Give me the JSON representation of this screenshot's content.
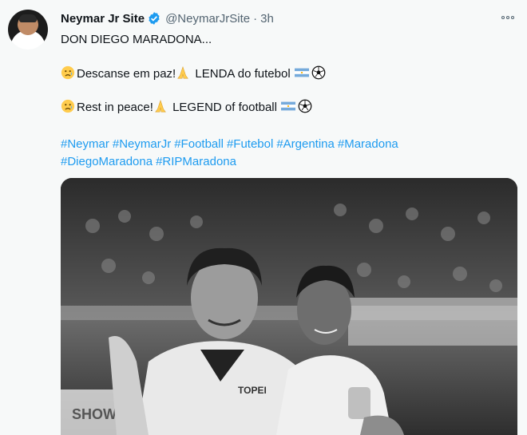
{
  "tweet": {
    "author_name": "Neymar Jr Site",
    "handle": "@NeymarJrSite",
    "separator": "·",
    "time": "3h",
    "line1": "DON DIEGO MARADONA...",
    "line2_text_a": "Descanse em paz!",
    "line2_text_b": "LENDA do futebol",
    "line3_text_a": "Rest in peace!",
    "line3_text_b": "LEGEND of football",
    "hashtags": [
      "#Neymar",
      "#NeymarJr",
      "#Football",
      "#Futebol",
      "#Argentina",
      "#Maradona",
      "#DiegoMaradona",
      "#RIPMaradona"
    ],
    "jersey_text": "TOPEI",
    "banner_text": "SHOW"
  },
  "icons": {
    "verified": "verified-badge-icon",
    "more": "more-options-icon",
    "sad_face": "sad-face-emoji",
    "praying_hands": "praying-hands-emoji",
    "argentina_flag": "argentina-flag-emoji",
    "soccer_ball": "soccer-ball-emoji"
  },
  "colors": {
    "link": "#1d9bf0",
    "secondary_text": "#536471",
    "background": "#f7f9f9"
  }
}
